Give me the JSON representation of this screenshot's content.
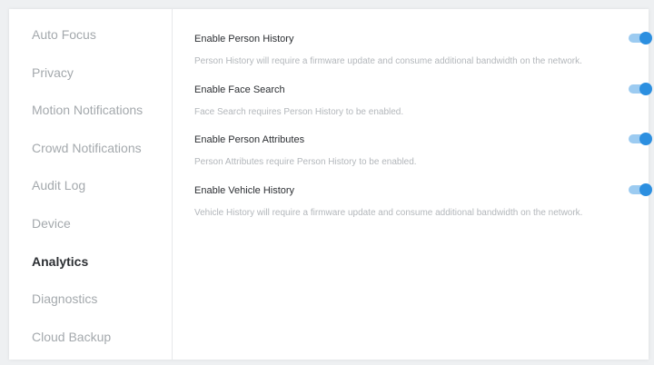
{
  "sidebar": {
    "items": [
      {
        "label": "Auto Focus"
      },
      {
        "label": "Privacy"
      },
      {
        "label": "Motion Notifications"
      },
      {
        "label": "Crowd Notifications"
      },
      {
        "label": "Audit Log"
      },
      {
        "label": "Device"
      },
      {
        "label": "Analytics"
      },
      {
        "label": "Diagnostics"
      },
      {
        "label": "Cloud Backup"
      }
    ],
    "active": "Analytics"
  },
  "settings": [
    {
      "title": "Enable Person History",
      "description": "Person History will require a firmware update and consume additional bandwidth on the network.",
      "enabled": true
    },
    {
      "title": "Enable Face Search",
      "description": "Face Search requires Person History to be enabled.",
      "enabled": true
    },
    {
      "title": "Enable Person Attributes",
      "description": "Person Attributes require Person History to be enabled.",
      "enabled": true
    },
    {
      "title": "Enable Vehicle History",
      "description": "Vehicle History will require a firmware update and consume additional bandwidth on the network.",
      "enabled": true
    }
  ],
  "colors": {
    "toggle_on": "#2c8fe0",
    "toggle_track": "#9ccbf1",
    "active_nav": "#2c2f33",
    "inactive_nav": "#a4a9ad"
  }
}
